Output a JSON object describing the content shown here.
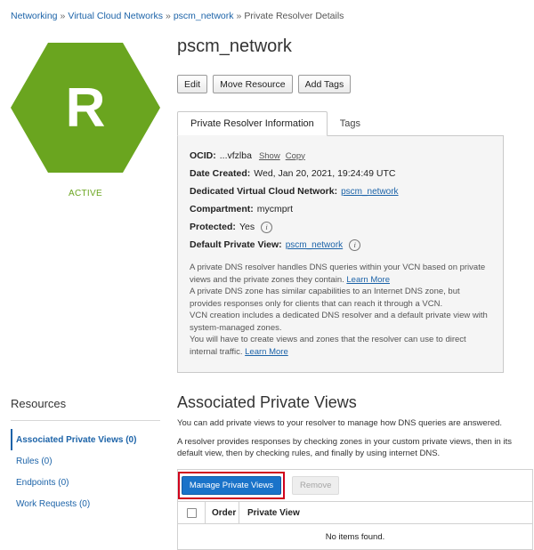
{
  "breadcrumb": {
    "items": [
      "Networking",
      "Virtual Cloud Networks",
      "pscm_network"
    ],
    "current": "Private Resolver Details",
    "separator": "»"
  },
  "resource": {
    "icon_letter": "R",
    "icon_color": "#6aa51f",
    "status": "ACTIVE",
    "title": "pscm_network"
  },
  "actions": {
    "edit": "Edit",
    "move": "Move Resource",
    "add_tags": "Add Tags"
  },
  "tabs": {
    "info": "Private Resolver Information",
    "tags": "Tags"
  },
  "info": {
    "ocid_label": "OCID:",
    "ocid_value": "...vfzlba",
    "show": "Show",
    "copy": "Copy",
    "date_label": "Date Created:",
    "date_value": "Wed, Jan 20, 2021, 19:24:49 UTC",
    "vcn_label": "Dedicated Virtual Cloud Network:",
    "vcn_value": "pscm_network",
    "compartment_label": "Compartment:",
    "compartment_value": "mycmprt",
    "protected_label": "Protected:",
    "protected_value": "Yes",
    "default_view_label": "Default Private View:",
    "default_view_value": "pscm_network",
    "desc1": "A private DNS resolver handles DNS queries within your VCN based on private views and the private zones they contain.",
    "learn_more": "Learn More",
    "desc2": "A private DNS zone has similar capabilities to an Internet DNS zone, but provides responses only for clients that can reach it through a VCN.",
    "desc3": "VCN creation includes a dedicated DNS resolver and a default private view with system-managed zones.",
    "desc4": "You will have to create views and zones that the resolver can use to direct internal traffic."
  },
  "resources": {
    "heading": "Resources",
    "items": [
      "Associated Private Views (0)",
      "Rules (0)",
      "Endpoints (0)",
      "Work Requests (0)"
    ]
  },
  "section": {
    "title": "Associated Private Views",
    "p1": "You can add private views to your resolver to manage how DNS queries are answered.",
    "p2": "A resolver provides responses by checking zones in your custom private views, then in its default view, then by checking rules, and finally by using internet DNS.",
    "manage_button": "Manage Private Views",
    "remove_button": "Remove",
    "columns": [
      "Order",
      "Private View"
    ],
    "empty": "No items found."
  }
}
